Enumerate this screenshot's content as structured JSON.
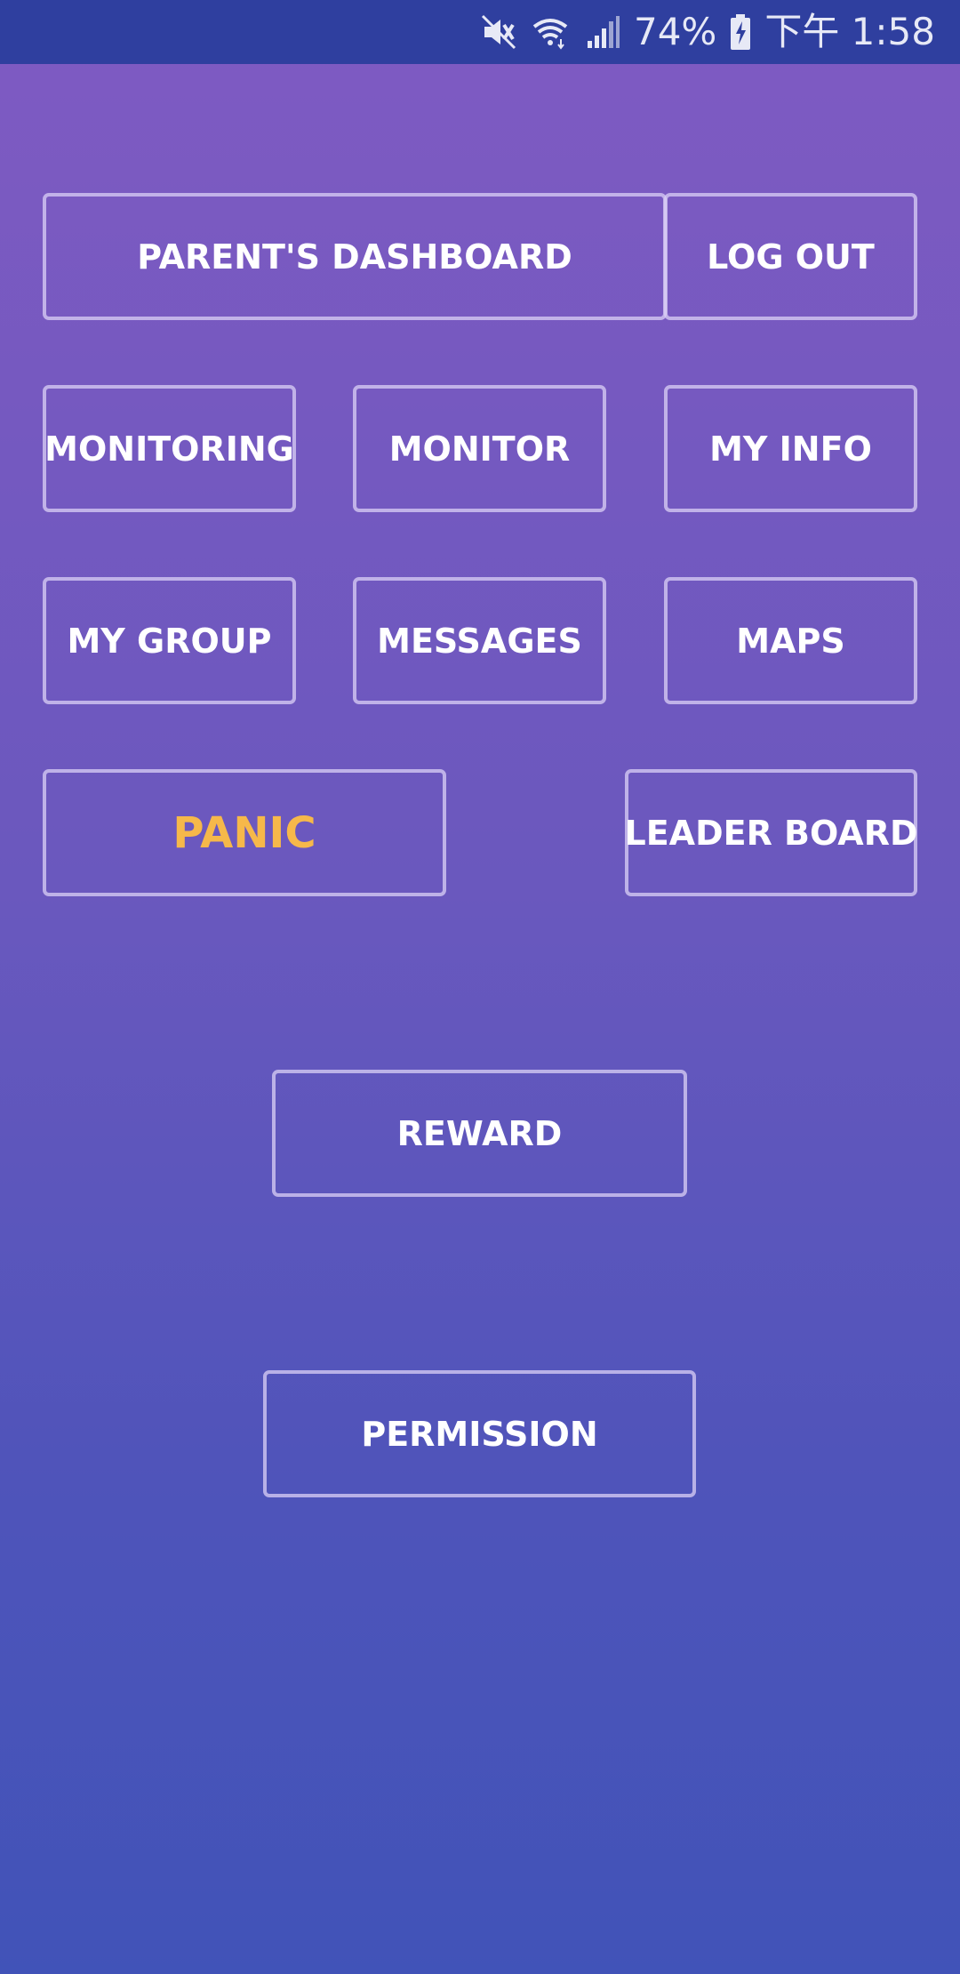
{
  "status_bar": {
    "battery": "74%",
    "time": "下午 1:58",
    "icons": [
      "mute-icon",
      "wifi-icon",
      "signal-icon",
      "battery-charging-icon"
    ]
  },
  "buttons": {
    "parents_dashboard": "PARENT'S DASHBOARD",
    "log_out": "LOG OUT",
    "monitoring": "MONITORING",
    "monitor": "MONITOR",
    "my_info": "MY INFO",
    "my_group": "MY GROUP",
    "messages": "MESSAGES",
    "maps": "MAPS",
    "panic": "PANIC",
    "leader_board": "LEADER BOARD",
    "reward": "REWARD",
    "permission": "PERMISSION"
  },
  "colors": {
    "status_bar_bg": "#2f3f9f",
    "gradient_top": "#7f5ac2",
    "gradient_bottom": "#4153b8",
    "panic_text": "#f6b84a",
    "button_text": "#ffffff"
  }
}
